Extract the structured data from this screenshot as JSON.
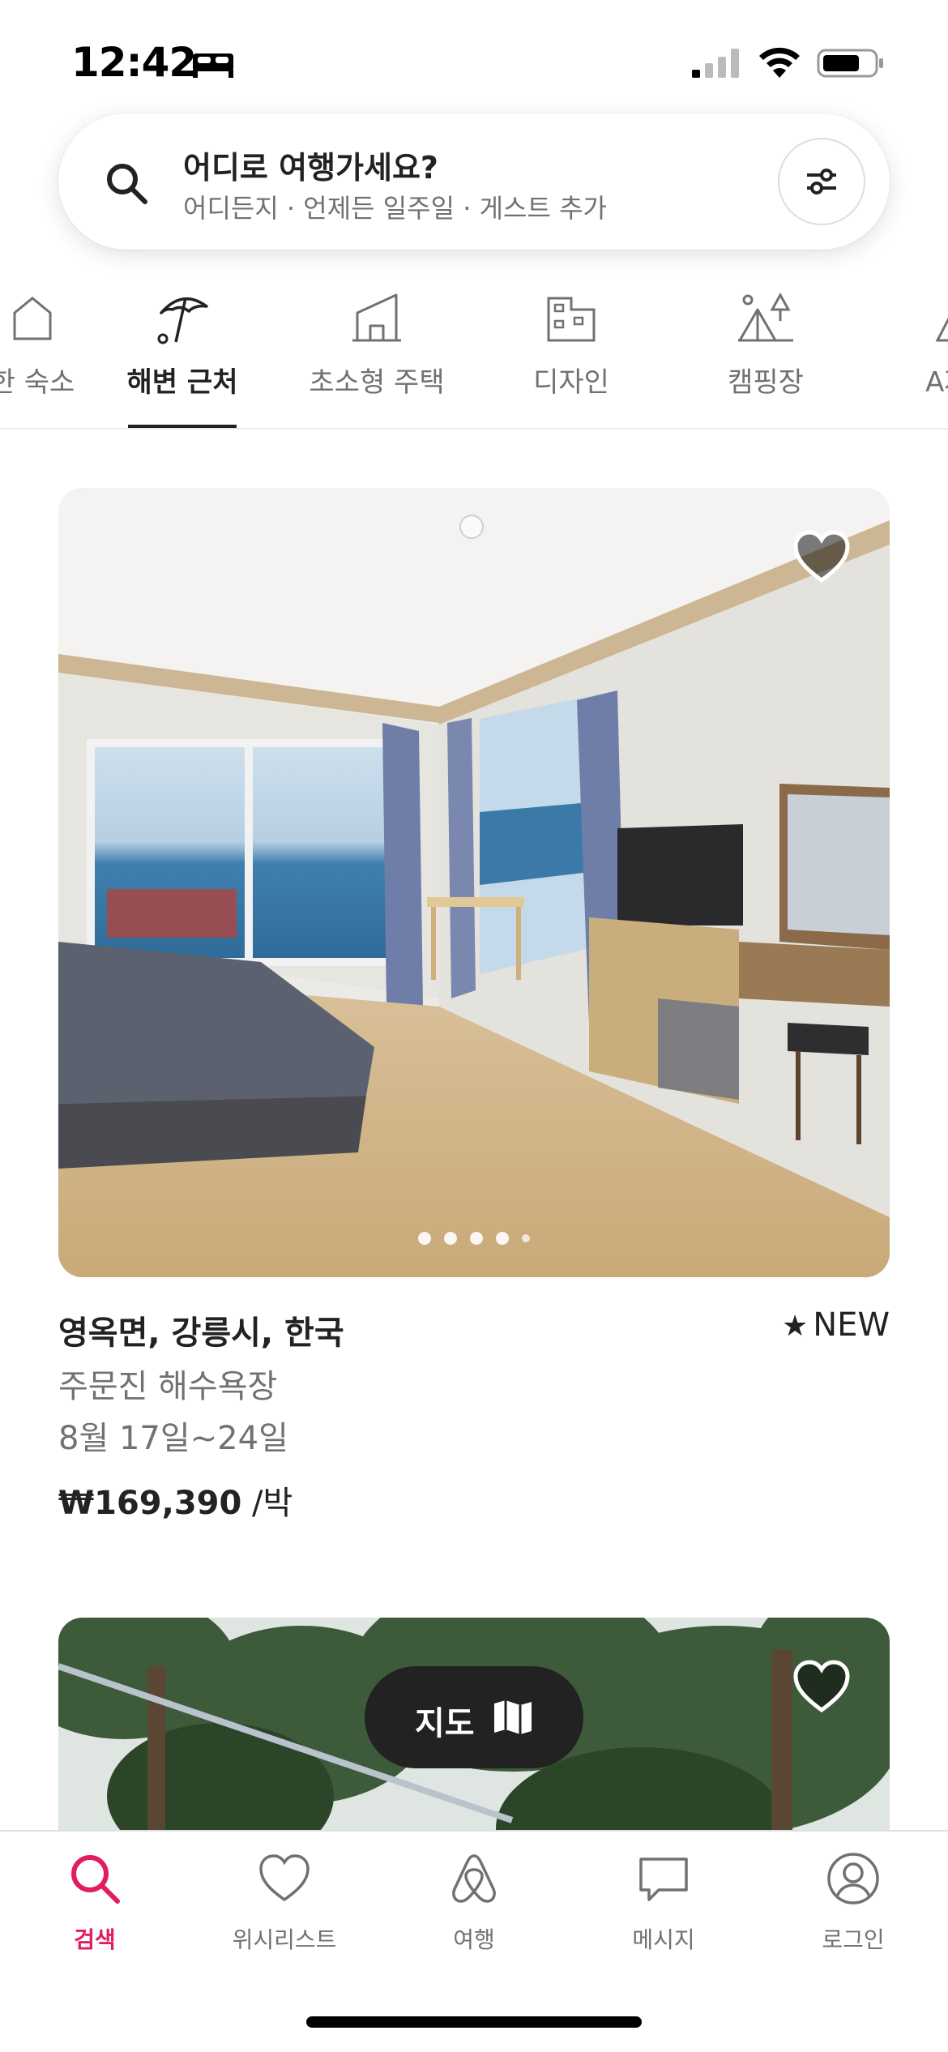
{
  "status_bar": {
    "time": "12:42"
  },
  "search": {
    "title": "어디로 여행가세요?",
    "subtitle": "어디든지 · 언제든 일주일 · 게스트 추가"
  },
  "categories": [
    {
      "label": "한 숙소",
      "icon": "house-icon",
      "active": false
    },
    {
      "label": "해변 근처",
      "icon": "beach-umbrella-icon",
      "active": true
    },
    {
      "label": "초소형 주택",
      "icon": "tiny-house-icon",
      "active": false
    },
    {
      "label": "디자인",
      "icon": "design-building-icon",
      "active": false
    },
    {
      "label": "캠핑장",
      "icon": "camping-tent-icon",
      "active": false
    },
    {
      "label": "A자형",
      "icon": "a-frame-icon",
      "active": false
    }
  ],
  "listing": {
    "title": "영옥면, 강릉시, 한국",
    "rating": "NEW",
    "subtitle": "주문진 해수욕장",
    "dates": "8월 17일~24일",
    "price": "₩169,390",
    "price_unit": " /박",
    "photo_count": 5,
    "current_photo": 1
  },
  "map_button": {
    "label": "지도"
  },
  "bottom_nav": [
    {
      "label": "검색",
      "icon": "search-icon",
      "active": true
    },
    {
      "label": "위시리스트",
      "icon": "heart-icon",
      "active": false
    },
    {
      "label": "여행",
      "icon": "airbnb-logo-icon",
      "active": false
    },
    {
      "label": "메시지",
      "icon": "message-icon",
      "active": false
    },
    {
      "label": "로그인",
      "icon": "profile-icon",
      "active": false
    }
  ],
  "colors": {
    "accent": "#E31C5F",
    "text": "#222222",
    "muted": "#717171"
  }
}
